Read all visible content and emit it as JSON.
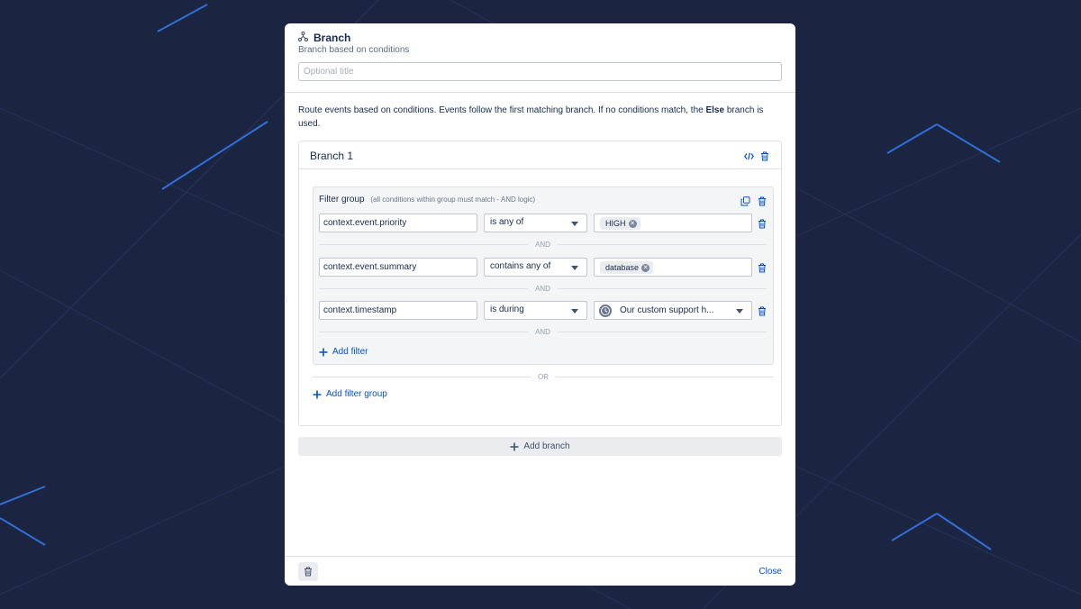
{
  "header": {
    "title": "Branch",
    "subtitle": "Branch based on conditions",
    "title_placeholder": "Optional title",
    "icon": "branch-icon"
  },
  "description": {
    "text_before": "Route events based on conditions. Events follow the first matching branch. If no conditions match, the",
    "bold": "Else",
    "text_after": "branch is used."
  },
  "branch": {
    "title": "Branch 1",
    "filter_group": {
      "label": "Filter group",
      "note": "(all conditions within group must match - AND logic)",
      "filters": [
        {
          "field": "context.event.priority",
          "operator": "is any of",
          "tags": [
            "HIGH"
          ]
        },
        {
          "field": "context.event.summary",
          "operator": "contains any of",
          "tags": [
            "database"
          ]
        },
        {
          "field": "context.timestamp",
          "operator": "is during",
          "selected": "Our custom support h..."
        }
      ],
      "and_label": "AND",
      "add_filter": "Add filter"
    },
    "or_label": "OR",
    "add_filter_group": "Add filter group"
  },
  "add_branch": "Add branch",
  "footer": {
    "close": "Close"
  },
  "colors": {
    "accent": "#0052cc",
    "background": "#1b2542",
    "modal": "#ffffff"
  }
}
